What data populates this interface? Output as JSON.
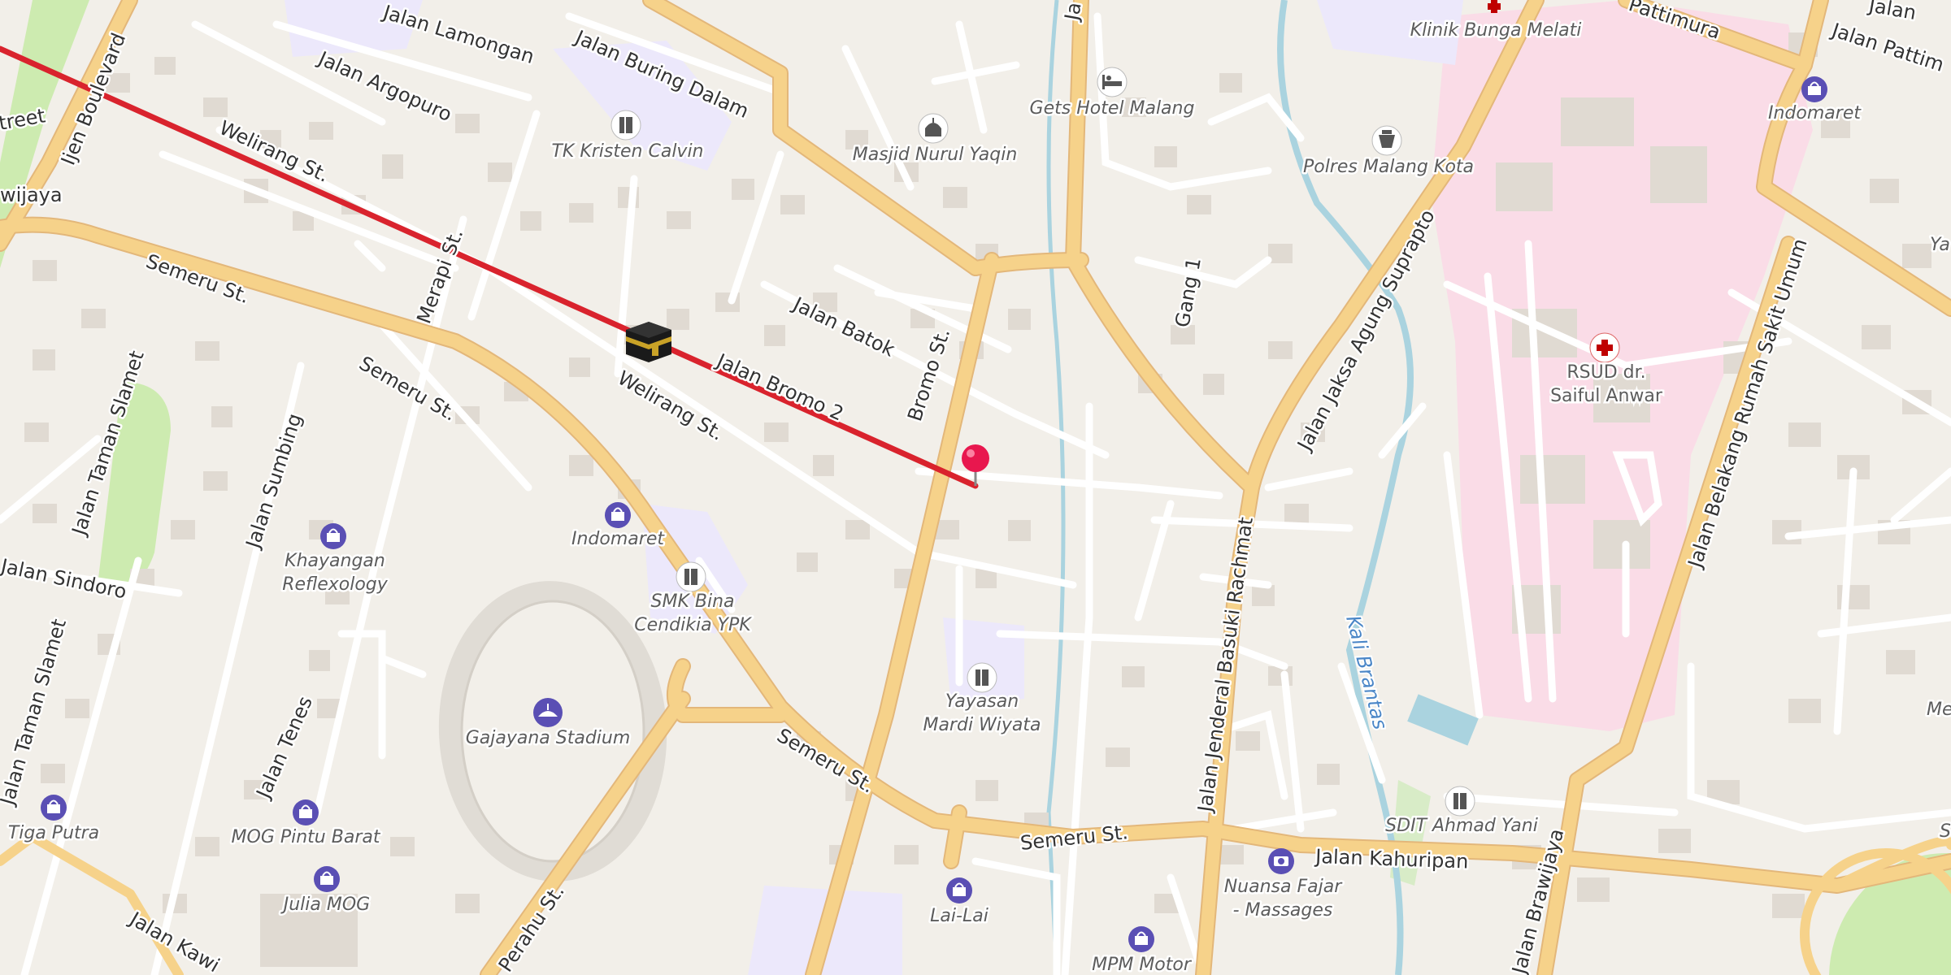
{
  "map": {
    "streets": [
      {
        "id": "lamongan",
        "name": "Jalan Lamongan"
      },
      {
        "id": "argopuro",
        "name": "Jalan Argopuro"
      },
      {
        "id": "buring",
        "name": "Jalan Buring Dalam"
      },
      {
        "id": "welirang1",
        "name": "Welirang St."
      },
      {
        "id": "welirang2",
        "name": "Welirang St."
      },
      {
        "id": "merapi",
        "name": "Merapi St."
      },
      {
        "id": "semeru1",
        "name": "Semeru St."
      },
      {
        "id": "semeru2",
        "name": "Semeru St."
      },
      {
        "id": "semeru3",
        "name": "Semeru St."
      },
      {
        "id": "semeru4",
        "name": "Semeru St."
      },
      {
        "id": "ijen",
        "name": "Ijen Boulevard"
      },
      {
        "id": "street",
        "name": "treet"
      },
      {
        "id": "wijaya",
        "name": "wijaya"
      },
      {
        "id": "batok",
        "name": "Jalan Batok"
      },
      {
        "id": "bromo2",
        "name": "Jalan Bromo 2"
      },
      {
        "id": "bromo",
        "name": "Bromo St."
      },
      {
        "id": "gang1",
        "name": "Gang 1"
      },
      {
        "id": "jaksa",
        "name": "Jalan Jaksa Agung Suprapto"
      },
      {
        "id": "basuki",
        "name": "Jalan Jenderal Basuki Rachmat"
      },
      {
        "id": "kahuripan",
        "name": "Jalan Kahuripan"
      },
      {
        "id": "brawijaya",
        "name": "Jalan Brawijaya"
      },
      {
        "id": "pattimura1",
        "name": "Pattimura"
      },
      {
        "id": "pattimura2",
        "name": "Jalan Pattim"
      },
      {
        "id": "jalan",
        "name": "Jalan"
      },
      {
        "id": "belakang",
        "name": "Jalan Belakang Rumah Sakit Umum"
      },
      {
        "id": "tamanslamet1",
        "name": "Jalan Taman Slamet"
      },
      {
        "id": "tamanslamet2",
        "name": "Jalan Taman Slamet"
      },
      {
        "id": "sumbing",
        "name": "Jalan Sumbing"
      },
      {
        "id": "sindoro",
        "name": "Jalan Sindoro"
      },
      {
        "id": "tenes",
        "name": "Jalan Tenes"
      },
      {
        "id": "perahu",
        "name": "Perahu St."
      },
      {
        "id": "kawi",
        "name": "Jalan Kawi"
      },
      {
        "id": "ja",
        "name": "Ja"
      }
    ],
    "river_label": "Kali Brantas",
    "pois": [
      {
        "id": "klinik",
        "type": "hospital",
        "label": "Klinik Bunga Melati"
      },
      {
        "id": "indomaret_ne",
        "type": "shop",
        "label": "Indomaret"
      },
      {
        "id": "gets",
        "type": "hotel",
        "label": "Gets Hotel Malang"
      },
      {
        "id": "masjid",
        "type": "mosque",
        "label": "Masjid Nurul Yaqin"
      },
      {
        "id": "tk",
        "type": "school",
        "label": "TK Kristen Calvin"
      },
      {
        "id": "polres",
        "type": "police",
        "label": "Polres Malang Kota"
      },
      {
        "id": "rsud",
        "type": "hospital",
        "label": "RSUD dr.",
        "label2": "Saiful Anwar"
      },
      {
        "id": "indomaret_c",
        "type": "shop",
        "label": "Indomaret"
      },
      {
        "id": "khayangan",
        "type": "shop",
        "label": "Khayangan",
        "label2": "Reflexology"
      },
      {
        "id": "smk",
        "type": "school",
        "label": "SMK Bina",
        "label2": "Cendikia YPK"
      },
      {
        "id": "gajayana",
        "type": "stadium",
        "label": "Gajayana Stadium"
      },
      {
        "id": "yayasan",
        "type": "school",
        "label": "Yayasan",
        "label2": "Mardi Wiyata"
      },
      {
        "id": "tiga",
        "type": "shop",
        "label": "Tiga Putra"
      },
      {
        "id": "mog",
        "type": "shop",
        "label": "MOG Pintu Barat"
      },
      {
        "id": "julia",
        "type": "shop",
        "label": "Julia MOG"
      },
      {
        "id": "lailai",
        "type": "shop",
        "label": "Lai-Lai"
      },
      {
        "id": "nuansa",
        "type": "camera",
        "label": "Nuansa Fajar",
        "label2": "- Massages"
      },
      {
        "id": "mpm",
        "type": "shop",
        "label": "MPM Motor"
      },
      {
        "id": "sdit",
        "type": "school",
        "label": "SDIT Ahmad Yani"
      }
    ],
    "partial_labels": [
      {
        "id": "ya",
        "label": "Ya"
      },
      {
        "id": "me",
        "label": "Me"
      },
      {
        "id": "s",
        "label": "S"
      }
    ],
    "route_color": "#d9232d",
    "marker_color": "#e8174e",
    "kaaba_icon": "kaaba-icon",
    "marker_icon": "map-pin-icon"
  }
}
